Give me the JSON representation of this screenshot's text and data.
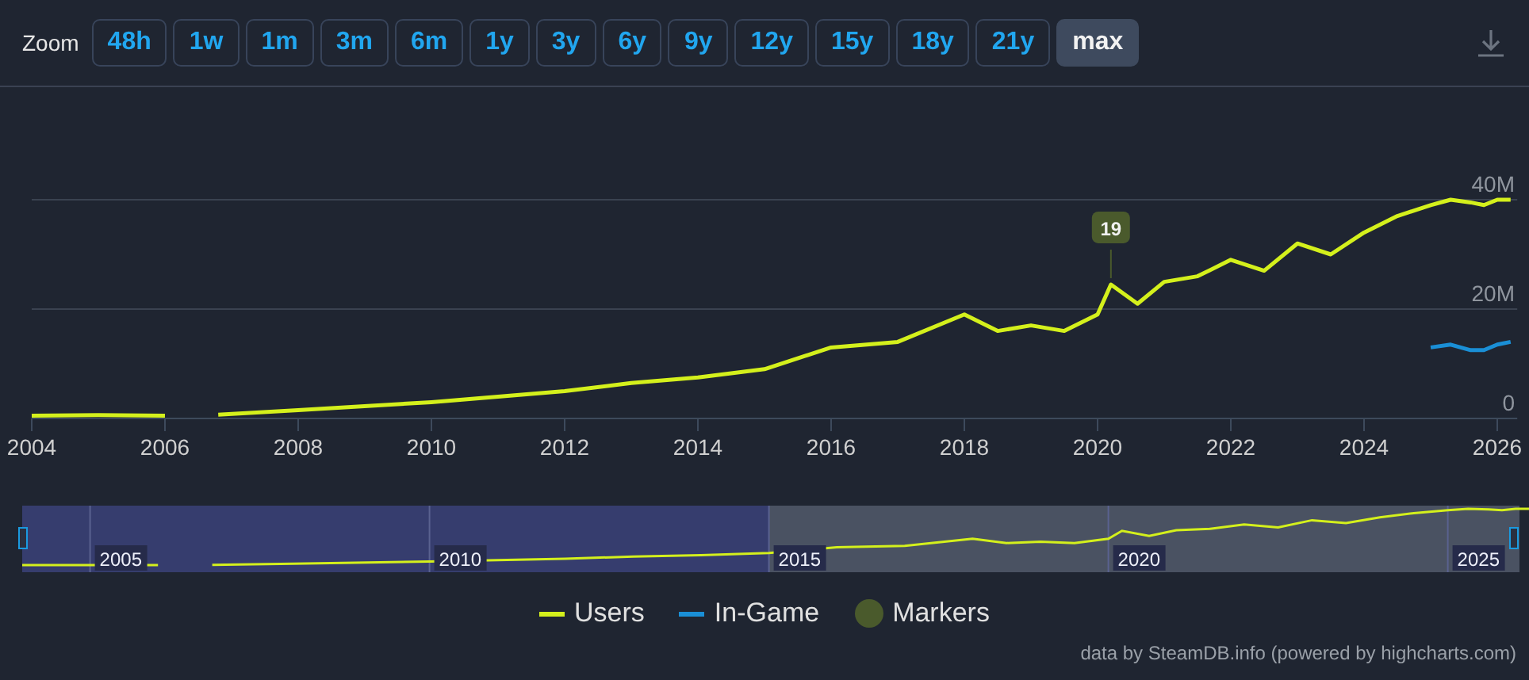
{
  "toolbar": {
    "zoom_label": "Zoom",
    "ranges": [
      {
        "label": "48h",
        "selected": false
      },
      {
        "label": "1w",
        "selected": false
      },
      {
        "label": "1m",
        "selected": false
      },
      {
        "label": "3m",
        "selected": false
      },
      {
        "label": "6m",
        "selected": false
      },
      {
        "label": "1y",
        "selected": false
      },
      {
        "label": "3y",
        "selected": false
      },
      {
        "label": "6y",
        "selected": false
      },
      {
        "label": "9y",
        "selected": false
      },
      {
        "label": "12y",
        "selected": false
      },
      {
        "label": "15y",
        "selected": false
      },
      {
        "label": "18y",
        "selected": false
      },
      {
        "label": "21y",
        "selected": false
      },
      {
        "label": "max",
        "selected": true
      }
    ]
  },
  "chart": {
    "chart_data": {
      "type": "line",
      "x": [
        2004,
        2005,
        2006,
        2006.4,
        2006.8,
        2008,
        2010,
        2012,
        2013,
        2014,
        2015,
        2016,
        2017,
        2018,
        2018.5,
        2019,
        2019.5,
        2020,
        2020.2,
        2020.6,
        2021,
        2021.5,
        2022,
        2022.5,
        2023,
        2023.5,
        2024,
        2024.5,
        2025,
        2025.3,
        2025.6,
        2025.8,
        2026,
        2026.2
      ],
      "series": [
        {
          "name": "Users",
          "color": "#d4f01c",
          "values": [
            0.5,
            0.6,
            0.5,
            null,
            0.7,
            1.5,
            3,
            5,
            6.5,
            7.5,
            9,
            13,
            14,
            19,
            16,
            17,
            16,
            19,
            24.5,
            21,
            25,
            26,
            29,
            27,
            32,
            30,
            34,
            37,
            39,
            40,
            39.5,
            39,
            40,
            40
          ]
        },
        {
          "name": "In-Game",
          "color": "#1a8fd6",
          "values": [
            null,
            null,
            null,
            null,
            null,
            null,
            null,
            null,
            null,
            null,
            null,
            null,
            null,
            null,
            null,
            null,
            null,
            null,
            null,
            null,
            null,
            null,
            null,
            null,
            null,
            null,
            null,
            null,
            13,
            13.5,
            12.5,
            12.5,
            13.5,
            14
          ]
        }
      ],
      "xlim": [
        2004,
        2026.3
      ],
      "ylim": [
        0,
        40
      ],
      "xticks": [
        2004,
        2006,
        2008,
        2010,
        2012,
        2014,
        2016,
        2018,
        2020,
        2022,
        2024,
        2026
      ],
      "yticks": [
        {
          "value": 0,
          "label": "0"
        },
        {
          "value": 20,
          "label": "20M"
        },
        {
          "value": 40,
          "label": "40M"
        }
      ],
      "annotations": [
        {
          "x": 2020.2,
          "y": 24.5,
          "text": "19"
        }
      ]
    }
  },
  "navigator": {
    "labels": [
      "2005",
      "2010",
      "2015",
      "2020",
      "2025"
    ]
  },
  "legend": [
    {
      "label": "Markers",
      "kind": "dot",
      "color": "#4a5a2c"
    }
  ],
  "credits": "data by SteamDB.info (powered by highcharts.com)"
}
